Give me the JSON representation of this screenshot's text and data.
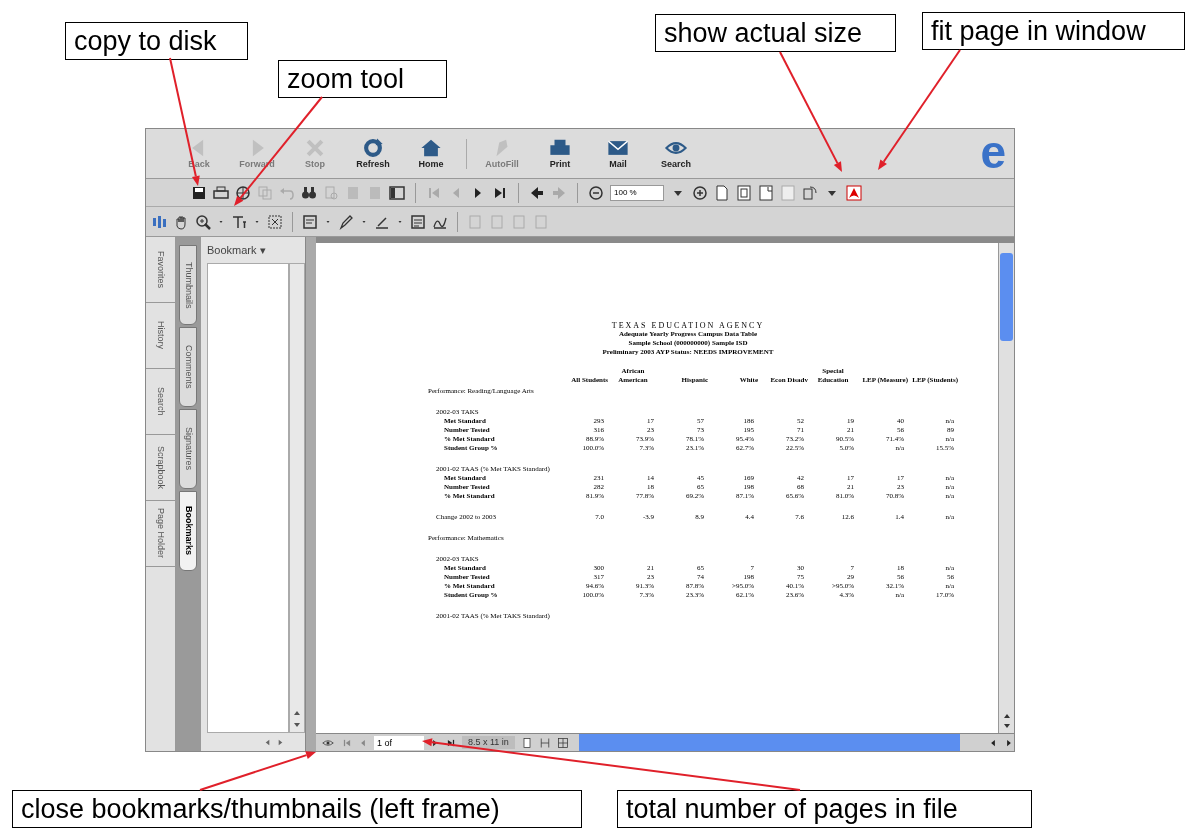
{
  "annotations": [
    {
      "label": "copy to disk"
    },
    {
      "label": "zoom tool"
    },
    {
      "label": "show actual size"
    },
    {
      "label": "fit page in window"
    },
    {
      "label": "close bookmarks/thumbnails (left frame)"
    },
    {
      "label": "total number of pages in file"
    }
  ],
  "browser_toolbar": {
    "buttons": [
      {
        "label": "Back",
        "disabled": true
      },
      {
        "label": "Forward",
        "disabled": true
      },
      {
        "label": "Stop",
        "disabled": true
      },
      {
        "label": "Refresh",
        "disabled": false
      },
      {
        "label": "Home",
        "disabled": false
      },
      {
        "label": "AutoFill",
        "disabled": true
      },
      {
        "label": "Print",
        "disabled": false
      },
      {
        "label": "Mail",
        "disabled": false
      },
      {
        "label": "Search",
        "disabled": false
      }
    ],
    "logo": "e"
  },
  "acrobat_toolbar": {
    "zoom_field": "100 %"
  },
  "explorer_tabs": [
    "Favorites",
    "History",
    "Search",
    "Scrapbook",
    "Page Holder"
  ],
  "acrobat_tabs": [
    {
      "label": "Thumbnails",
      "selected": false
    },
    {
      "label": "Comments",
      "selected": false
    },
    {
      "label": "Signatures",
      "selected": false
    },
    {
      "label": "Bookmarks",
      "selected": true
    }
  ],
  "bookmark_panel": {
    "menu": "Bookmark ▾"
  },
  "document": {
    "heading": [
      "TEXAS EDUCATION AGENCY",
      "Adequate Yearly Progress Campus Data Table",
      "Sample School (000000000) Sample ISD",
      "Preliminary 2003 AYP Status: NEEDS IMPROVEMENT"
    ],
    "columns": [
      "All Students",
      "African American",
      "Hispanic",
      "White",
      "Econ Disadv",
      "Special Education",
      "LEP (Measure)",
      "LEP (Students)"
    ],
    "sections": [
      {
        "title": "Performance: Reading/Language Arts",
        "groups": [
          {
            "title": "2002-03 TAKS",
            "rows": [
              {
                "label": "Met Standard",
                "values": [
                  "293",
                  "17",
                  "57",
                  "186",
                  "52",
                  "19",
                  "40",
                  "n/a"
                ]
              },
              {
                "label": "Number Tested",
                "values": [
                  "316",
                  "23",
                  "73",
                  "195",
                  "71",
                  "21",
                  "56",
                  "89"
                ]
              },
              {
                "label": "% Met Standard",
                "values": [
                  "88.9%",
                  "73.9%",
                  "78.1%",
                  "95.4%",
                  "73.2%",
                  "90.5%",
                  "71.4%",
                  "n/a"
                ]
              },
              {
                "label": "Student Group %",
                "values": [
                  "100.0%",
                  "7.3%",
                  "23.1%",
                  "62.7%",
                  "22.5%",
                  "5.0%",
                  "n/a",
                  "15.5%"
                ]
              }
            ]
          },
          {
            "title": "2001-02 TAAS (% Met TAKS Standard)",
            "rows": [
              {
                "label": "Met Standard",
                "values": [
                  "231",
                  "14",
                  "45",
                  "169",
                  "42",
                  "17",
                  "17",
                  "n/a"
                ]
              },
              {
                "label": "Number Tested",
                "values": [
                  "282",
                  "18",
                  "65",
                  "198",
                  "68",
                  "21",
                  "23",
                  "n/a"
                ]
              },
              {
                "label": "% Met Standard",
                "values": [
                  "81.9%",
                  "77.8%",
                  "69.2%",
                  "87.1%",
                  "65.6%",
                  "81.0%",
                  "70.8%",
                  "n/a"
                ]
              }
            ]
          },
          {
            "rows": [
              {
                "label": "Change 2002 to 2003",
                "values": [
                  "7.0",
                  "-3.9",
                  "8.9",
                  "4.4",
                  "7.6",
                  "12.6",
                  "1.4",
                  "n/a"
                ]
              }
            ]
          }
        ]
      },
      {
        "title": "Performance: Mathematics",
        "groups": [
          {
            "title": "2002-03 TAKS",
            "rows": [
              {
                "label": "Met Standard",
                "values": [
                  "300",
                  "21",
                  "65",
                  "7",
                  "30",
                  "7",
                  "18",
                  "n/a"
                ]
              },
              {
                "label": "Number Tested",
                "values": [
                  "317",
                  "23",
                  "74",
                  "198",
                  "75",
                  "29",
                  "56",
                  "56"
                ]
              },
              {
                "label": "% Met Standard",
                "values": [
                  "94.6%",
                  "91.3%",
                  "87.8%",
                  ">95.0%",
                  "40.1%",
                  ">95.0%",
                  "32.1%",
                  "n/a"
                ]
              },
              {
                "label": "Student Group %",
                "values": [
                  "100.0%",
                  "7.3%",
                  "23.3%",
                  "62.1%",
                  "23.6%",
                  "4.3%",
                  "n/a",
                  "17.0%"
                ]
              }
            ]
          },
          {
            "title": "2001-02 TAAS (% Met TAKS Standard)"
          }
        ]
      }
    ]
  },
  "status_bar": {
    "page_field": "1 of",
    "page_size": "8.5 x 11 in"
  }
}
